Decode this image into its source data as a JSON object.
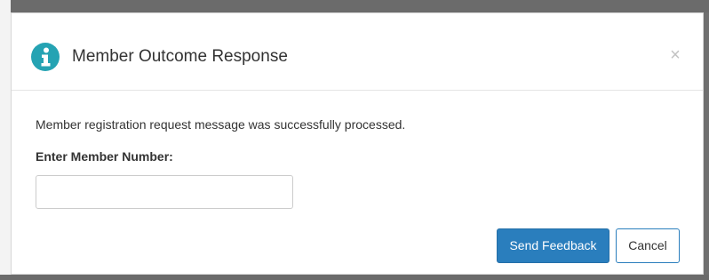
{
  "dialog": {
    "title": "Member Outcome Response",
    "close_symbol": "×",
    "header_icon": "info-icon",
    "icon_color": "#25a3b3"
  },
  "body": {
    "message": "Member registration request message was successfully processed.",
    "field_label": "Enter Member Number:",
    "member_number_value": "",
    "member_number_placeholder": ""
  },
  "footer": {
    "send_label": "Send Feedback",
    "cancel_label": "Cancel",
    "primary_color": "#2a7ebd"
  }
}
